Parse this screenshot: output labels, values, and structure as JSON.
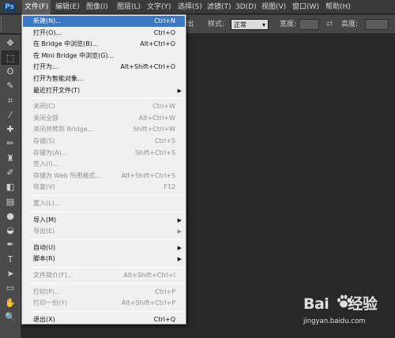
{
  "app": {
    "logo": "Ps"
  },
  "menubar": {
    "items": [
      "文件(F)",
      "编辑(E)",
      "图像(I)",
      "图层(L)",
      "文字(Y)",
      "选择(S)",
      "滤镜(T)",
      "3D(D)",
      "视图(V)",
      "窗口(W)",
      "帮助(H)"
    ],
    "active_index": 0
  },
  "options_bar": {
    "feather_label_partial": "出",
    "style_label": "样式:",
    "style_value": "正常",
    "width_label": "宽度:",
    "height_label": "高度:",
    "swap_icon": "swap-arrows-icon"
  },
  "file_menu": {
    "items": [
      {
        "label": "新建(N)...",
        "shortcut": "Ctrl+N",
        "enabled": true,
        "highlighted": true
      },
      {
        "label": "打开(O)...",
        "shortcut": "Ctrl+O",
        "enabled": true
      },
      {
        "label": "在 Bridge 中浏览(B)...",
        "shortcut": "Alt+Ctrl+O",
        "enabled": true
      },
      {
        "label": "在 Mini Bridge 中浏览(G)...",
        "shortcut": "",
        "enabled": true
      },
      {
        "label": "打开为...",
        "shortcut": "Alt+Shift+Ctrl+O",
        "enabled": true
      },
      {
        "label": "打开为智能对象...",
        "shortcut": "",
        "enabled": true
      },
      {
        "label": "最近打开文件(T)",
        "shortcut": "",
        "enabled": true,
        "submenu": true
      },
      {
        "separator": true
      },
      {
        "label": "关闭(C)",
        "shortcut": "Ctrl+W",
        "enabled": false
      },
      {
        "label": "关闭全部",
        "shortcut": "Alt+Ctrl+W",
        "enabled": false
      },
      {
        "label": "关闭并转到 Bridge...",
        "shortcut": "Shift+Ctrl+W",
        "enabled": false
      },
      {
        "label": "存储(S)",
        "shortcut": "Ctrl+S",
        "enabled": false
      },
      {
        "label": "存储为(A)...",
        "shortcut": "Shift+Ctrl+S",
        "enabled": false
      },
      {
        "label": "签入(I)...",
        "shortcut": "",
        "enabled": false
      },
      {
        "label": "存储为 Web 所用格式...",
        "shortcut": "Alt+Shift+Ctrl+S",
        "enabled": false
      },
      {
        "label": "恢复(V)",
        "shortcut": "F12",
        "enabled": false
      },
      {
        "separator": true
      },
      {
        "label": "置入(L)...",
        "shortcut": "",
        "enabled": false
      },
      {
        "separator": true
      },
      {
        "label": "导入(M)",
        "shortcut": "",
        "enabled": true,
        "submenu": true
      },
      {
        "label": "导出(E)",
        "shortcut": "",
        "enabled": false,
        "submenu": true
      },
      {
        "separator": true
      },
      {
        "label": "自动(U)",
        "shortcut": "",
        "enabled": true,
        "submenu": true
      },
      {
        "label": "脚本(R)",
        "shortcut": "",
        "enabled": true,
        "submenu": true
      },
      {
        "separator": true
      },
      {
        "label": "文件简介(F)...",
        "shortcut": "Alt+Shift+Ctrl+I",
        "enabled": false
      },
      {
        "separator": true
      },
      {
        "label": "打印(P)...",
        "shortcut": "Ctrl+P",
        "enabled": false
      },
      {
        "label": "打印一份(Y)",
        "shortcut": "Alt+Shift+Ctrl+P",
        "enabled": false
      },
      {
        "separator": true
      },
      {
        "label": "退出(X)",
        "shortcut": "Ctrl+Q",
        "enabled": true
      }
    ]
  },
  "tools": [
    {
      "icon": "move-tool-icon",
      "glyph": "✥"
    },
    {
      "icon": "rectangular-marquee-icon",
      "glyph": "⬚",
      "selected": true
    },
    {
      "icon": "lasso-icon",
      "glyph": "ʘ"
    },
    {
      "icon": "quick-selection-icon",
      "glyph": "✎"
    },
    {
      "icon": "crop-icon",
      "glyph": "⌗"
    },
    {
      "icon": "eyedropper-icon",
      "glyph": "⁄"
    },
    {
      "icon": "spot-healing-icon",
      "glyph": "✚"
    },
    {
      "icon": "brush-icon",
      "glyph": "✏"
    },
    {
      "icon": "clone-stamp-icon",
      "glyph": "♜"
    },
    {
      "icon": "history-brush-icon",
      "glyph": "✐"
    },
    {
      "icon": "eraser-icon",
      "glyph": "◧"
    },
    {
      "icon": "gradient-icon",
      "glyph": "▤"
    },
    {
      "icon": "blur-icon",
      "glyph": "●"
    },
    {
      "icon": "dodge-icon",
      "glyph": "◒"
    },
    {
      "icon": "pen-icon",
      "glyph": "✒"
    },
    {
      "icon": "type-icon",
      "glyph": "T"
    },
    {
      "icon": "path-selection-icon",
      "glyph": "➤"
    },
    {
      "icon": "rectangle-shape-icon",
      "glyph": "▭"
    },
    {
      "icon": "hand-icon",
      "glyph": "✋"
    },
    {
      "icon": "zoom-icon",
      "glyph": "🔍"
    }
  ],
  "watermark": {
    "logo_text_left": "Bai",
    "logo_text_right": "经验",
    "url": "jingyan.baidu.com"
  }
}
